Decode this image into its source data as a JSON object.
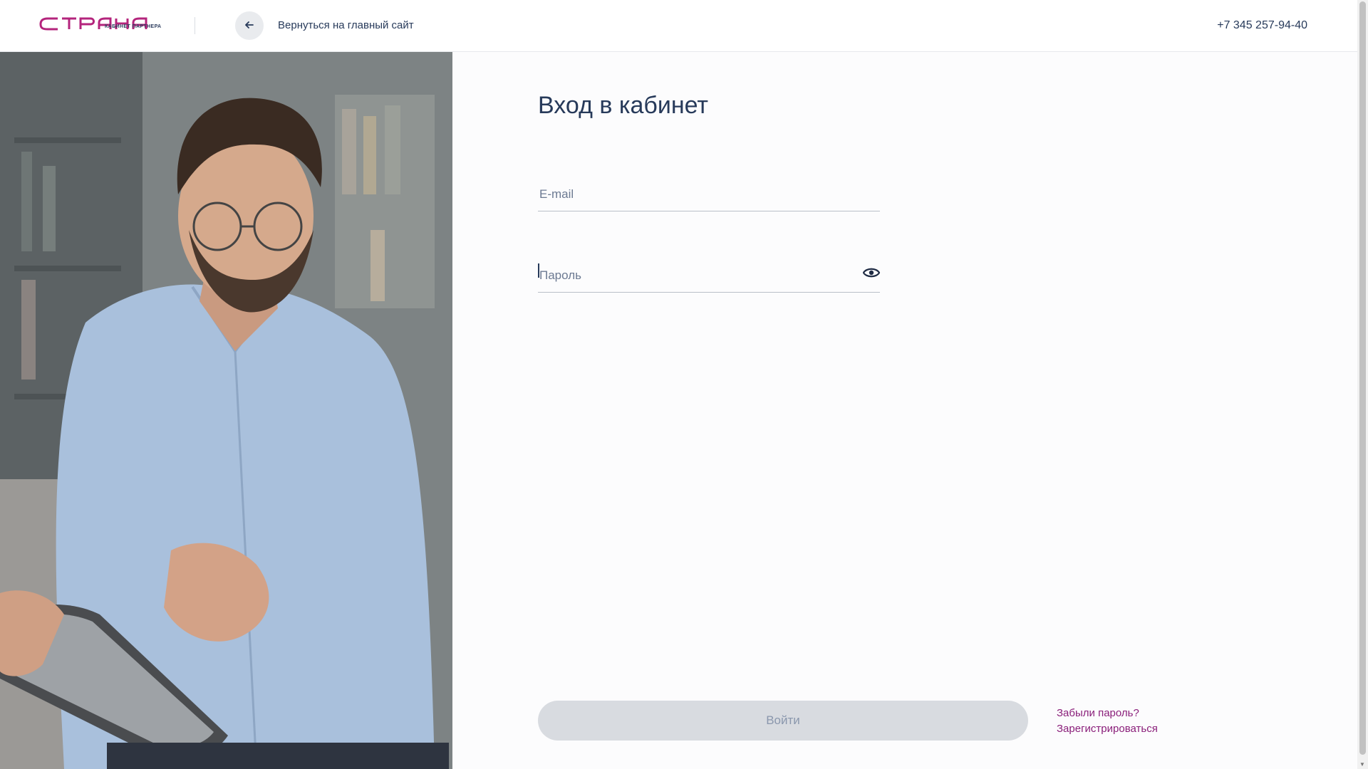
{
  "header": {
    "logo_text": "СТРАНА",
    "logo_caption": "КАБИНЕТ ПАРТНЕРА",
    "back_link": "Вернуться на главный сайт",
    "phone": "+7 345 257-94-40"
  },
  "form": {
    "title": "Вход в кабинет",
    "email_placeholder": "E-mail",
    "password_placeholder": "Пароль",
    "submit_label": "Войти",
    "forgot_link": "Забыли пароль?",
    "register_link": "Зарегистрироваться"
  },
  "colors": {
    "brand_magenta": "#b4247c",
    "link_purple": "#8a1f7a",
    "text_navy": "#273a5a",
    "button_disabled": "#d8dbe0"
  },
  "icons": {
    "back": "arrow-left-icon",
    "eye": "eye-icon"
  }
}
